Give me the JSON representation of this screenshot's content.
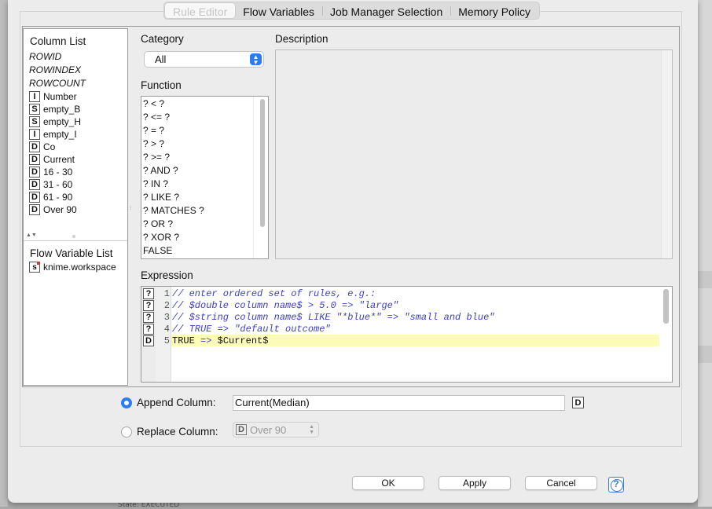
{
  "tabs": [
    "Rule Editor",
    "Flow Variables",
    "Job Manager Selection",
    "Memory Policy"
  ],
  "column_list": {
    "title": "Column List",
    "special": [
      "ROWID",
      "ROWINDEX",
      "ROWCOUNT"
    ],
    "columns": [
      {
        "type": "I",
        "name": "Number"
      },
      {
        "type": "S",
        "name": "empty_B"
      },
      {
        "type": "S",
        "name": "empty_H"
      },
      {
        "type": "I",
        "name": "empty_I"
      },
      {
        "type": "D",
        "name": "Co"
      },
      {
        "type": "D",
        "name": "Current"
      },
      {
        "type": "D",
        "name": "16 - 30"
      },
      {
        "type": "D",
        "name": "31 - 60"
      },
      {
        "type": "D",
        "name": "61 - 90"
      },
      {
        "type": "D",
        "name": "Over 90"
      }
    ]
  },
  "flow_variables": {
    "title": "Flow Variable List",
    "items": [
      {
        "type": "s",
        "name": "knime.workspace"
      }
    ]
  },
  "category": {
    "label": "Category",
    "value": "All"
  },
  "function": {
    "label": "Function",
    "items": [
      "? < ?",
      "? <= ?",
      "? = ?",
      "? > ?",
      "? >= ?",
      "? AND ?",
      "? IN ?",
      "? LIKE ?",
      "? MATCHES ?",
      "? OR ?",
      "? XOR ?",
      "FALSE"
    ]
  },
  "description": {
    "label": "Description"
  },
  "expression": {
    "label": "Expression",
    "lines": [
      {
        "num": "1",
        "icon": "?",
        "text": "// enter ordered set of rules, e.g.:"
      },
      {
        "num": "2",
        "icon": "?",
        "text": "// $double column name$ > 5.0 => \"large\""
      },
      {
        "num": "3",
        "icon": "?",
        "text": "// $string column name$ LIKE \"*blue*\" => \"small and blue\""
      },
      {
        "num": "4",
        "icon": "?",
        "text": "// TRUE => \"default outcome\""
      },
      {
        "num": "5",
        "icon": "D",
        "kw": "TRUE",
        "op": "=>",
        "var": "$Current$"
      }
    ]
  },
  "append": {
    "label": "Append Column:",
    "value": "Current(Median)",
    "type": "D"
  },
  "replace": {
    "label": "Replace Column:",
    "type": "D",
    "value": "Over 90"
  },
  "buttons": {
    "ok": "OK",
    "apply": "Apply",
    "cancel": "Cancel",
    "help": "?"
  },
  "background": {
    "status_fragment": "State:    EXECUTED"
  }
}
